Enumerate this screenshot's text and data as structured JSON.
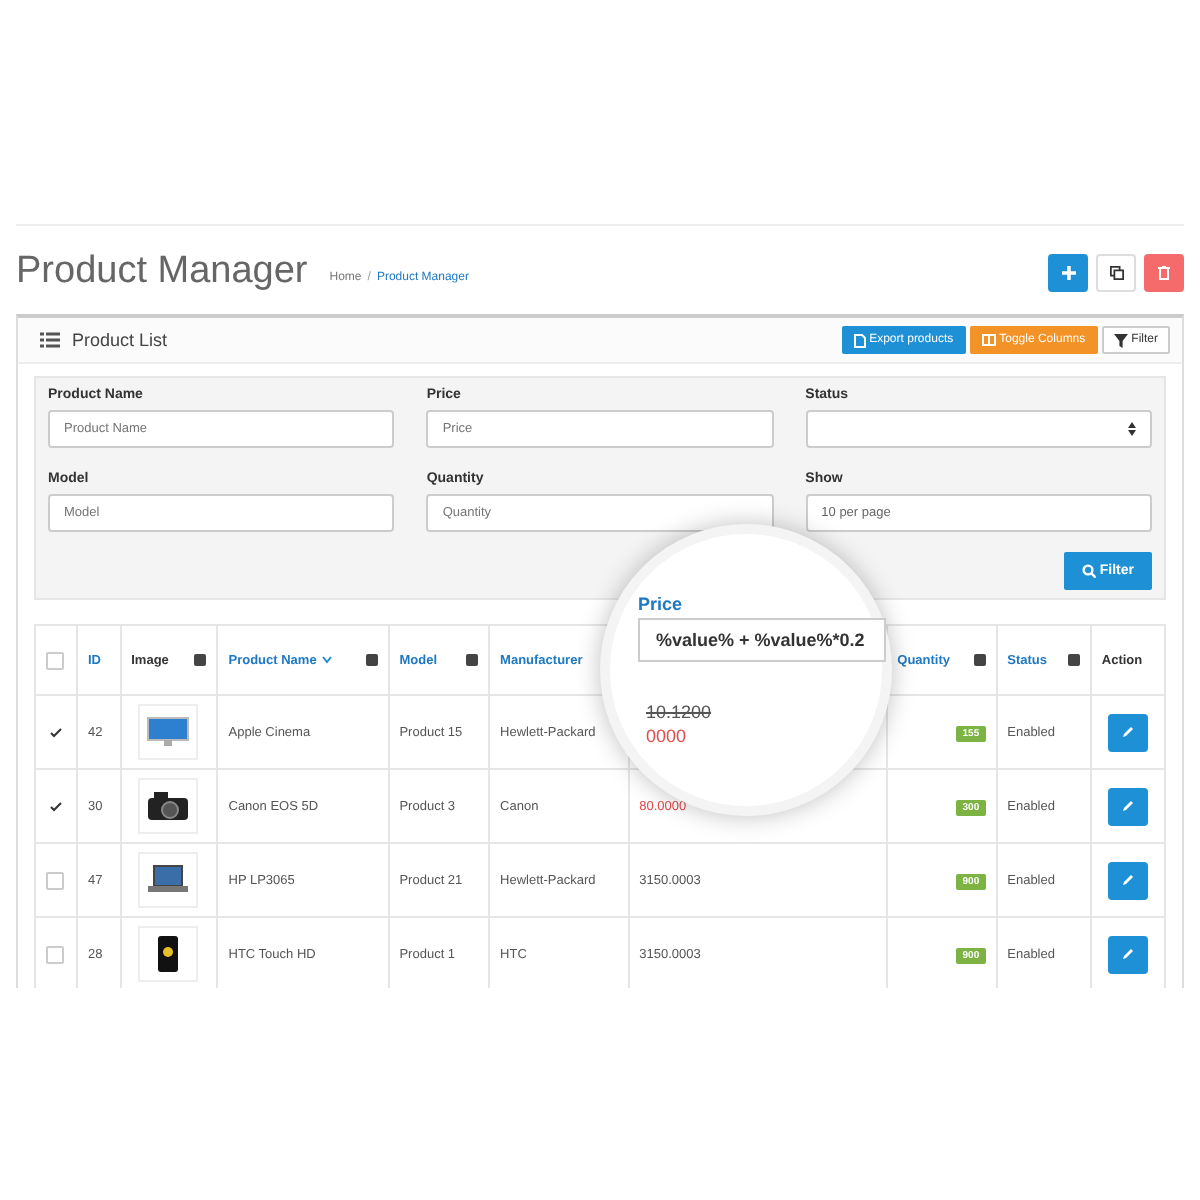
{
  "header": {
    "title": "Product Manager",
    "separator": "/",
    "breadcrumb": [
      {
        "label": "Home",
        "current": false
      },
      {
        "label": "Product Manager",
        "current": true
      }
    ]
  },
  "panel": {
    "title": "Product List",
    "buttons": [
      {
        "kind": "export",
        "label": "Export products"
      },
      {
        "kind": "toggle",
        "label": "Toggle Columns"
      },
      {
        "kind": "filter",
        "label": "Filter"
      }
    ]
  },
  "filters": [
    {
      "label": "Product Name",
      "kind": "text",
      "placeholder": "Product Name"
    },
    {
      "label": "Price",
      "kind": "text",
      "placeholder": "Price"
    },
    {
      "label": "Status",
      "kind": "select"
    },
    {
      "label": "Model",
      "kind": "text",
      "placeholder": "Model"
    },
    {
      "label": "Quantity",
      "kind": "text",
      "placeholder": "Quantity"
    },
    {
      "label": "Show",
      "kind": "value",
      "value": "10 per page"
    }
  ],
  "filter_button": "Filter",
  "table": {
    "all_checked": false,
    "columns": [
      {
        "label": "ID",
        "toggle": false,
        "sorted": false
      },
      {
        "label": "Image",
        "toggle": true,
        "sorted": false
      },
      {
        "label": "Product Name",
        "toggle": true,
        "sorted": true
      },
      {
        "label": "Model",
        "toggle": true,
        "sorted": false
      },
      {
        "label": "Manufacturer",
        "toggle": false,
        "sorted": false
      },
      {
        "label": "Quantity",
        "toggle": true,
        "sorted": false
      },
      {
        "label": "Status",
        "toggle": true,
        "sorted": false
      },
      {
        "label": "Action",
        "toggle": false,
        "sorted": false
      }
    ],
    "rows": [
      {
        "checked": true,
        "id": "42",
        "name": "Apple Cinema",
        "model": "Product 15",
        "manufacturer": "Hewlett-Packard",
        "quantity": "155",
        "status": "Enabled"
      },
      {
        "checked": true,
        "id": "30",
        "name": "Canon EOS 5D",
        "model": "Product 3",
        "manufacturer": "Canon",
        "special": "80.0000",
        "quantity": "300",
        "status": "Enabled"
      },
      {
        "checked": false,
        "id": "47",
        "name": "HP LP3065",
        "model": "Product 21",
        "manufacturer": "Hewlett-Packard",
        "price": "3150.0003",
        "quantity": "900",
        "status": "Enabled"
      },
      {
        "checked": false,
        "id": "28",
        "name": "HTC Touch HD",
        "model": "Product 1",
        "manufacturer": "HTC",
        "price": "3150.0003",
        "quantity": "900",
        "status": "Enabled"
      }
    ]
  },
  "magnifier": {
    "label": "Price",
    "value": "%value% + %value%*0.2",
    "old_price": "10.1200",
    "special": "0000"
  }
}
